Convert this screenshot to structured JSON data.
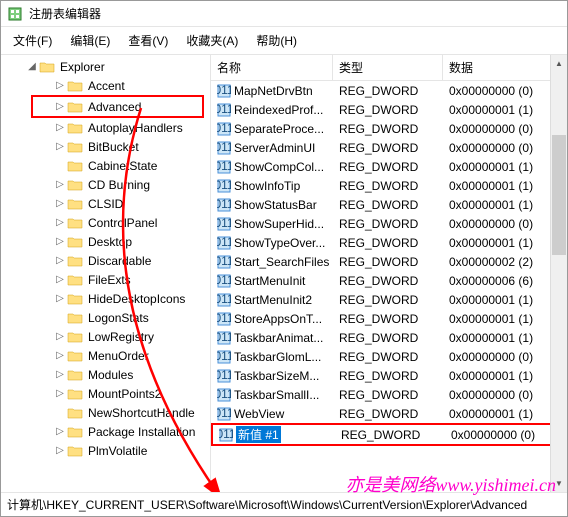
{
  "window": {
    "title": "注册表编辑器"
  },
  "menu": {
    "file": "文件(F)",
    "edit": "编辑(E)",
    "view": "查看(V)",
    "favorites": "收藏夹(A)",
    "help": "帮助(H)"
  },
  "tree": {
    "root": "Explorer",
    "children": [
      {
        "label": "Accent",
        "indent": 2,
        "exp": "▷"
      },
      {
        "label": "Advanced",
        "indent": 2,
        "exp": "▷",
        "highlight": true
      },
      {
        "label": "AutoplayHandlers",
        "indent": 2,
        "exp": "▷"
      },
      {
        "label": "BitBucket",
        "indent": 2,
        "exp": "▷"
      },
      {
        "label": "CabinetState",
        "indent": 2,
        "exp": ""
      },
      {
        "label": "CD Burning",
        "indent": 2,
        "exp": "▷"
      },
      {
        "label": "CLSID",
        "indent": 2,
        "exp": "▷"
      },
      {
        "label": "ControlPanel",
        "indent": 2,
        "exp": "▷"
      },
      {
        "label": "Desktop",
        "indent": 2,
        "exp": "▷"
      },
      {
        "label": "Discardable",
        "indent": 2,
        "exp": "▷"
      },
      {
        "label": "FileExts",
        "indent": 2,
        "exp": "▷"
      },
      {
        "label": "HideDesktopIcons",
        "indent": 2,
        "exp": "▷"
      },
      {
        "label": "LogonStats",
        "indent": 2,
        "exp": ""
      },
      {
        "label": "LowRegistry",
        "indent": 2,
        "exp": "▷"
      },
      {
        "label": "MenuOrder",
        "indent": 2,
        "exp": "▷"
      },
      {
        "label": "Modules",
        "indent": 2,
        "exp": "▷"
      },
      {
        "label": "MountPoints2",
        "indent": 2,
        "exp": "▷"
      },
      {
        "label": "NewShortcutHandle",
        "indent": 2,
        "exp": ""
      },
      {
        "label": "Package Installation",
        "indent": 2,
        "exp": "▷"
      },
      {
        "label": "PlmVolatile",
        "indent": 2,
        "exp": "▷"
      }
    ]
  },
  "list": {
    "headers": {
      "name": "名称",
      "type": "类型",
      "data": "数据"
    },
    "rows": [
      {
        "name": "MapNetDrvBtn",
        "type": "REG_DWORD",
        "data": "0x00000000 (0)"
      },
      {
        "name": "ReindexedProf...",
        "type": "REG_DWORD",
        "data": "0x00000001 (1)"
      },
      {
        "name": "SeparateProce...",
        "type": "REG_DWORD",
        "data": "0x00000000 (0)"
      },
      {
        "name": "ServerAdminUI",
        "type": "REG_DWORD",
        "data": "0x00000000 (0)"
      },
      {
        "name": "ShowCompCol...",
        "type": "REG_DWORD",
        "data": "0x00000001 (1)"
      },
      {
        "name": "ShowInfoTip",
        "type": "REG_DWORD",
        "data": "0x00000001 (1)"
      },
      {
        "name": "ShowStatusBar",
        "type": "REG_DWORD",
        "data": "0x00000001 (1)"
      },
      {
        "name": "ShowSuperHid...",
        "type": "REG_DWORD",
        "data": "0x00000000 (0)"
      },
      {
        "name": "ShowTypeOver...",
        "type": "REG_DWORD",
        "data": "0x00000001 (1)"
      },
      {
        "name": "Start_SearchFiles",
        "type": "REG_DWORD",
        "data": "0x00000002 (2)"
      },
      {
        "name": "StartMenuInit",
        "type": "REG_DWORD",
        "data": "0x00000006 (6)"
      },
      {
        "name": "StartMenuInit2",
        "type": "REG_DWORD",
        "data": "0x00000001 (1)"
      },
      {
        "name": "StoreAppsOnT...",
        "type": "REG_DWORD",
        "data": "0x00000001 (1)"
      },
      {
        "name": "TaskbarAnimat...",
        "type": "REG_DWORD",
        "data": "0x00000001 (1)"
      },
      {
        "name": "TaskbarGlomL...",
        "type": "REG_DWORD",
        "data": "0x00000000 (0)"
      },
      {
        "name": "TaskbarSizeM...",
        "type": "REG_DWORD",
        "data": "0x00000001 (1)"
      },
      {
        "name": "TaskbarSmallI...",
        "type": "REG_DWORD",
        "data": "0x00000000 (0)"
      },
      {
        "name": "WebView",
        "type": "REG_DWORD",
        "data": "0x00000001 (1)"
      },
      {
        "name": "新值 #1",
        "type": "REG_DWORD",
        "data": "0x00000000 (0)",
        "selected": true
      }
    ]
  },
  "statusbar": {
    "path": "计算机\\HKEY_CURRENT_USER\\Software\\Microsoft\\Windows\\CurrentVersion\\Explorer\\Advanced"
  },
  "watermark": "亦是美网络www.yishimei.cn"
}
